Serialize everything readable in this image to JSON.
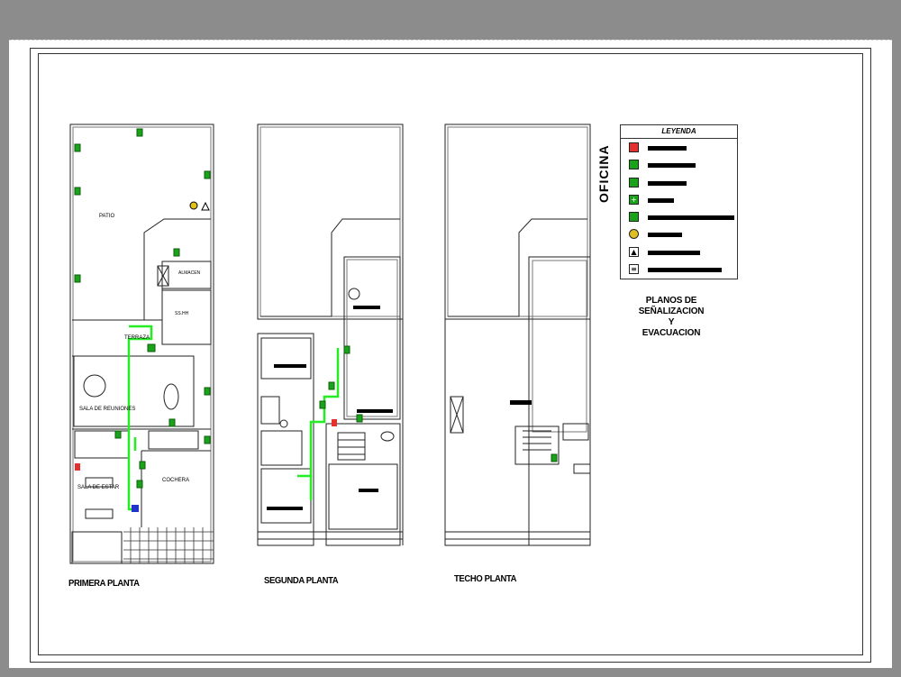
{
  "captions": {
    "primera": "PRIMERA PLANTA",
    "segunda": "SEGUNDA PLANTA",
    "techo": "TECHO PLANTA"
  },
  "rooms": {
    "patio": "PATIO",
    "almacen": "ALMACEN",
    "terraza": "TERRAZA",
    "sala_reuniones": "SALA DE REUNIONES",
    "sala_estar": "SALA DE ESTAR",
    "cochera": "COCHERA",
    "sshh": "SS.HH"
  },
  "legend": {
    "title": "LEYENDA",
    "items": [
      {
        "icon": "extinguisher-sign-icon",
        "color": "#e53030",
        "bar_fraction": 0.45
      },
      {
        "icon": "exit-sign-icon",
        "color": "#1aa31a",
        "bar_fraction": 0.55
      },
      {
        "icon": "evacuation-route-icon",
        "color": "#1aa31a",
        "bar_fraction": 0.45
      },
      {
        "icon": "first-aid-icon",
        "color": "#1aa31a",
        "bar_fraction": 0.3
      },
      {
        "icon": "emergency-exit-icon",
        "color": "#1aa31a",
        "bar_fraction": 1.0
      },
      {
        "icon": "safe-zone-icon",
        "color": "#e0c020",
        "bar_fraction": 0.4
      },
      {
        "icon": "electrical-hazard-icon",
        "color": "#ffffff",
        "bar_fraction": 0.6
      },
      {
        "icon": "stairs-icon",
        "color": "#ffffff",
        "bar_fraction": 0.85
      }
    ]
  },
  "side_title": "OFICINA",
  "plan_title": {
    "line1": "PLANOS DE",
    "line2": "SEÑALIZACION",
    "line3": "Y",
    "line4": "EVACUACION"
  },
  "colors": {
    "route": "#22ee22",
    "sign_green": "#1aa31a",
    "sign_red": "#e53030",
    "sign_blue": "#2233cc"
  }
}
